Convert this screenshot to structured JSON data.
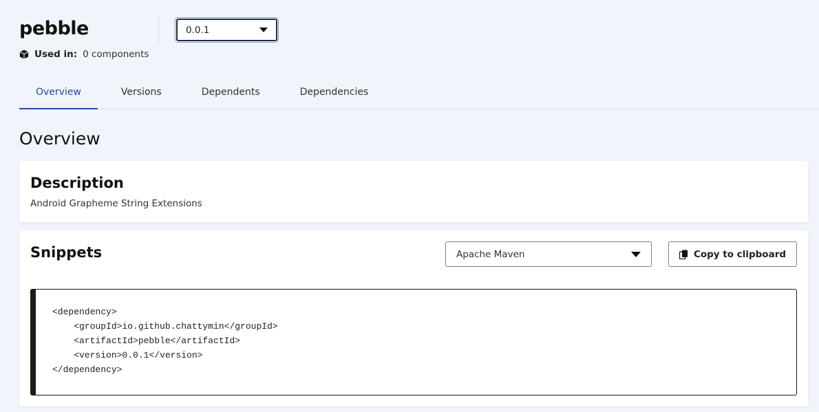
{
  "header": {
    "component_name": "pebble",
    "used_in_label": "Used in:",
    "used_in_value": "0 components",
    "version_selected": "0.0.1"
  },
  "tabs": [
    {
      "label": "Overview",
      "active": true
    },
    {
      "label": "Versions",
      "active": false
    },
    {
      "label": "Dependents",
      "active": false
    },
    {
      "label": "Dependencies",
      "active": false
    }
  ],
  "overview": {
    "title": "Overview",
    "description": {
      "heading": "Description",
      "text": "Android Grapheme String Extensions"
    },
    "snippets": {
      "heading": "Snippets",
      "format_selected": "Apache Maven",
      "copy_label": "Copy to clipboard",
      "code": "<dependency>\n    <groupId>io.github.chattymin</groupId>\n    <artifactId>pebble</artifactId>\n    <version>0.0.1</version>\n</dependency>"
    }
  },
  "colors": {
    "accent": "#1f4aa8",
    "background": "#f1f4fa"
  }
}
